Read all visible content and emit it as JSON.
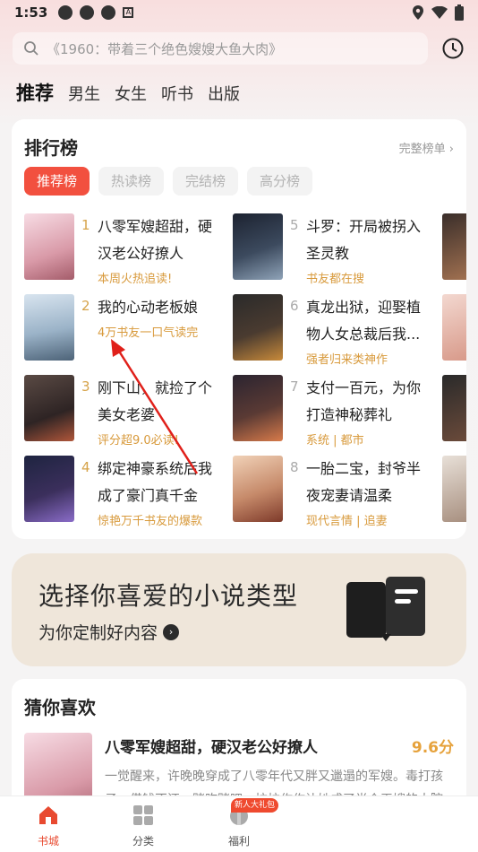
{
  "status": {
    "time": "1:53"
  },
  "search": {
    "placeholder": "《1960：带着三个绝色嫂嫂大鱼大肉》"
  },
  "tabs": [
    "推荐",
    "男生",
    "女生",
    "听书",
    "出版"
  ],
  "ranking": {
    "title": "排行榜",
    "more": "完整榜单",
    "chips": [
      "推荐榜",
      "热读榜",
      "完结榜",
      "高分榜"
    ],
    "items": [
      {
        "num": "1",
        "name": "八零军嫂超甜，硬汉老公好撩人",
        "tag": "本周火热追读!"
      },
      {
        "num": "2",
        "name": "我的心动老板娘",
        "tag": "4万书友一口气读完"
      },
      {
        "num": "3",
        "name": "刚下山，就捡了个美女老婆",
        "tag": "评分超9.0必读!"
      },
      {
        "num": "4",
        "name": "绑定神豪系统后我成了豪门真千金",
        "tag": "惊艳万千书友的爆款"
      },
      {
        "num": "5",
        "name": "斗罗：开局被拐入圣灵教",
        "tag": "书友都在搜"
      },
      {
        "num": "6",
        "name": "真龙出狱，迎娶植物人女总裁后我...",
        "tag": "强者归来类神作"
      },
      {
        "num": "7",
        "name": "支付一百元，为你打造神秘葬礼",
        "tag": "系统 | 都市"
      },
      {
        "num": "8",
        "name": "一胎二宝，封爷半夜宠妻请温柔",
        "tag": "现代言情 | 追妻"
      }
    ]
  },
  "promo": {
    "title": "选择你喜爱的小说类型",
    "subtitle": "为你定制好内容"
  },
  "guess": {
    "title": "猜你喜欢",
    "book_name": "八零军嫂超甜，硬汉老公好撩人",
    "score": "9.6分",
    "desc": "一觉醒来，许晚晚穿成了八零年代又胖又邋遢的军嫂。毒打孩子、借钱不还、赌咋赌吧，拉拉作作让她成了半个天嫂的大院"
  },
  "bottomnav": {
    "items": [
      "书城",
      "分类",
      "福利"
    ],
    "badge": "新人大礼包"
  },
  "colors": {
    "accent": "#f2503f",
    "tag": "#d89a3c",
    "score": "#e6a23c"
  }
}
